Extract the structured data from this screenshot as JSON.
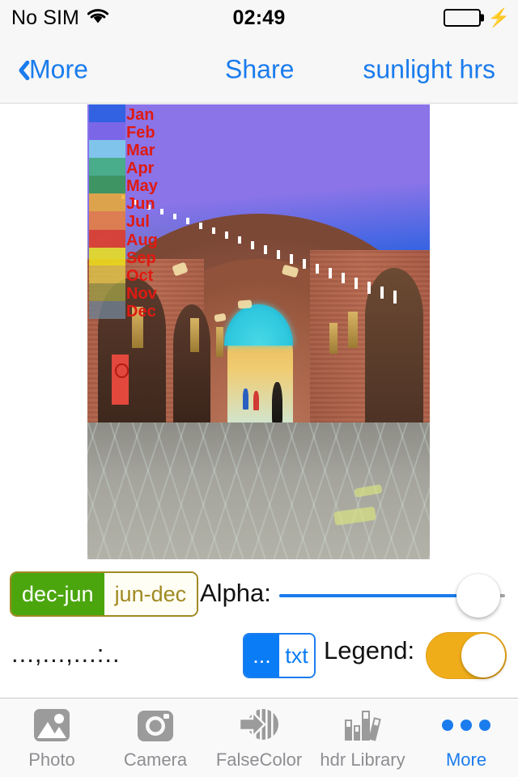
{
  "status_bar": {
    "carrier": "No SIM",
    "wifi_icon": "wifi-icon",
    "time": "02:49",
    "battery_icon": "battery-full-icon",
    "charging_icon": "lightning-bolt-icon"
  },
  "nav_bar": {
    "back_icon": "chevron-left-icon",
    "back_label": "More",
    "middle_action": "Share",
    "title": "sunlight hrs"
  },
  "legend": {
    "months": [
      {
        "label": "Jan",
        "color": "#1f5fe0"
      },
      {
        "label": "Feb",
        "color": "#7a63e8"
      },
      {
        "label": "Mar",
        "color": "#7fd6ec"
      },
      {
        "label": "Apr",
        "color": "#3bb977"
      },
      {
        "label": "May",
        "color": "#2e9c46"
      },
      {
        "label": "Jun",
        "color": "#f0ae2a"
      },
      {
        "label": "Jul",
        "color": "#f07f33"
      },
      {
        "label": "Aug",
        "color": "#e8381a"
      },
      {
        "label": "Sep",
        "color": "#f2e818"
      },
      {
        "label": "Oct",
        "color": "#ddc54a"
      },
      {
        "label": "Nov",
        "color": "#9a9a46"
      },
      {
        "label": "Dec",
        "color": "#6f8090"
      }
    ],
    "label_color": "#e01a12"
  },
  "photo": {
    "name": "false-color-sunlight-overlay-photo",
    "scene": "brick vaulted bazaar passage with turquoise tiled arch"
  },
  "controls": {
    "season_segment": {
      "options": [
        "dec-jun",
        "jun-dec"
      ],
      "selected": "dec-jun",
      "selected_color": "#4ba60e",
      "border_color": "#a08a22"
    },
    "alpha": {
      "label": "Alpha:",
      "value_percent": 88,
      "fill_color": "#1b7ced",
      "track_color": "#a6a6a6"
    },
    "coordinates": "...,...,...:..",
    "format_segment": {
      "options": [
        "...",
        "txt"
      ],
      "selected": "...",
      "selected_color": "#0a7cf5"
    },
    "legend_toggle": {
      "label": "Legend:",
      "on": true,
      "on_color": "#f0ad1a"
    }
  },
  "tab_bar": {
    "items": [
      {
        "label": "Photo",
        "icon": "photo-icon",
        "active": false
      },
      {
        "label": "Camera",
        "icon": "camera-icon",
        "active": false
      },
      {
        "label": "FalseColor",
        "icon": "falsecolor-icon",
        "active": false
      },
      {
        "label": "hdr Library",
        "icon": "books-icon",
        "active": false
      },
      {
        "label": "More",
        "icon": "ellipsis-icon",
        "active": true
      }
    ],
    "active_color": "#1b7ced",
    "inactive_color": "#8e8e93"
  }
}
